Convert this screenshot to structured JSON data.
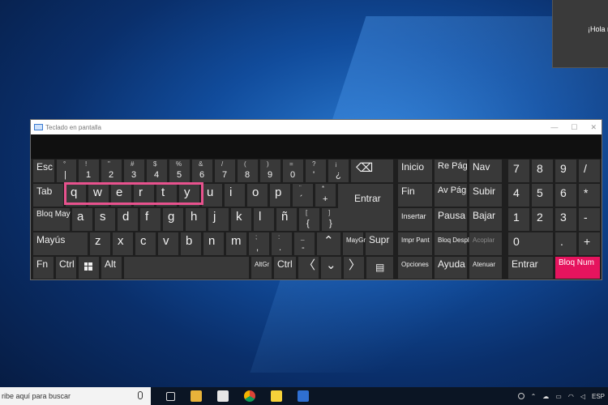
{
  "notification": {
    "text": "¡Hola n"
  },
  "window": {
    "title": "Teclado en pantalla"
  },
  "keys": {
    "esc": "Esc",
    "row1": [
      {
        "shift": "°",
        "main": "|"
      },
      {
        "shift": "!",
        "main": "1"
      },
      {
        "shift": "\"",
        "main": "2"
      },
      {
        "shift": "#",
        "main": "3"
      },
      {
        "shift": "$",
        "main": "4"
      },
      {
        "shift": "%",
        "main": "5"
      },
      {
        "shift": "&",
        "main": "6"
      },
      {
        "shift": "/",
        "main": "7"
      },
      {
        "shift": "(",
        "main": "8"
      },
      {
        "shift": ")",
        "main": "9"
      },
      {
        "shift": "=",
        "main": "0"
      },
      {
        "shift": "?",
        "main": "'"
      },
      {
        "shift": "¡",
        "main": "¿"
      }
    ],
    "backspace": "⌫",
    "tab": "Tab",
    "row2": [
      "q",
      "w",
      "e",
      "r",
      "t",
      "y",
      "u",
      "i",
      "o",
      "p"
    ],
    "acute": {
      "shift": "¨",
      "main": "´"
    },
    "plus": {
      "shift": "*",
      "main": "+"
    },
    "enter": "Entrar",
    "caps": "Bloq May",
    "row3": [
      "a",
      "s",
      "d",
      "f",
      "g",
      "h",
      "j",
      "k",
      "l",
      "ñ"
    ],
    "brace_open": {
      "shift": "[",
      "main": "{"
    },
    "brace_close": {
      "shift": "]",
      "main": "}"
    },
    "shift_left": "Mayús",
    "row4": [
      "z",
      "x",
      "c",
      "v",
      "b",
      "n",
      "m"
    ],
    "comma": {
      "shift": ";",
      "main": ","
    },
    "period": {
      "shift": ":",
      "main": "."
    },
    "dash": {
      "shift": "_",
      "main": "-"
    },
    "up_arrow": "⌃",
    "shift_right": "MayGr",
    "supr": "Supr",
    "fn": "Fn",
    "ctrl": "Ctrl",
    "alt": "Alt",
    "altgr": "AltGr",
    "ctrl_right": "Ctrl",
    "left_arrow": "〈",
    "down_arrow": "⌄",
    "right_arrow": "〉",
    "menu": "▤"
  },
  "nav_keys": {
    "inicio": "Inicio",
    "re_pag": "Re Pág",
    "nav": "Nav",
    "fin": "Fin",
    "av_pag": "Av Pág",
    "subir": "Subir",
    "insertar": "Insertar",
    "pausa": "Pausa",
    "bajar": "Bajar",
    "impr_pant": "Impr Pant",
    "bloq_despl": "Bloq Despl",
    "acoplar": "Acoplar",
    "opciones": "Opciones",
    "ayuda": "Ayuda",
    "atenuar": "Atenuar"
  },
  "numpad": {
    "row1": [
      "7",
      "8",
      "9",
      "/"
    ],
    "row2": [
      "4",
      "5",
      "6",
      "*"
    ],
    "row3": [
      "1",
      "2",
      "3",
      "-"
    ],
    "zero": "0",
    "dot": ".",
    "plus": "+",
    "enter": "Entrar",
    "bloq_num": "Bloq Num"
  },
  "taskbar": {
    "search_placeholder": "ribe aquí para buscar",
    "language": "ESP"
  },
  "colors": {
    "accent": "#e6145e",
    "highlight_border": "#e8528e",
    "key_bg": "#393939",
    "window_bg": "#1f1f1f"
  }
}
